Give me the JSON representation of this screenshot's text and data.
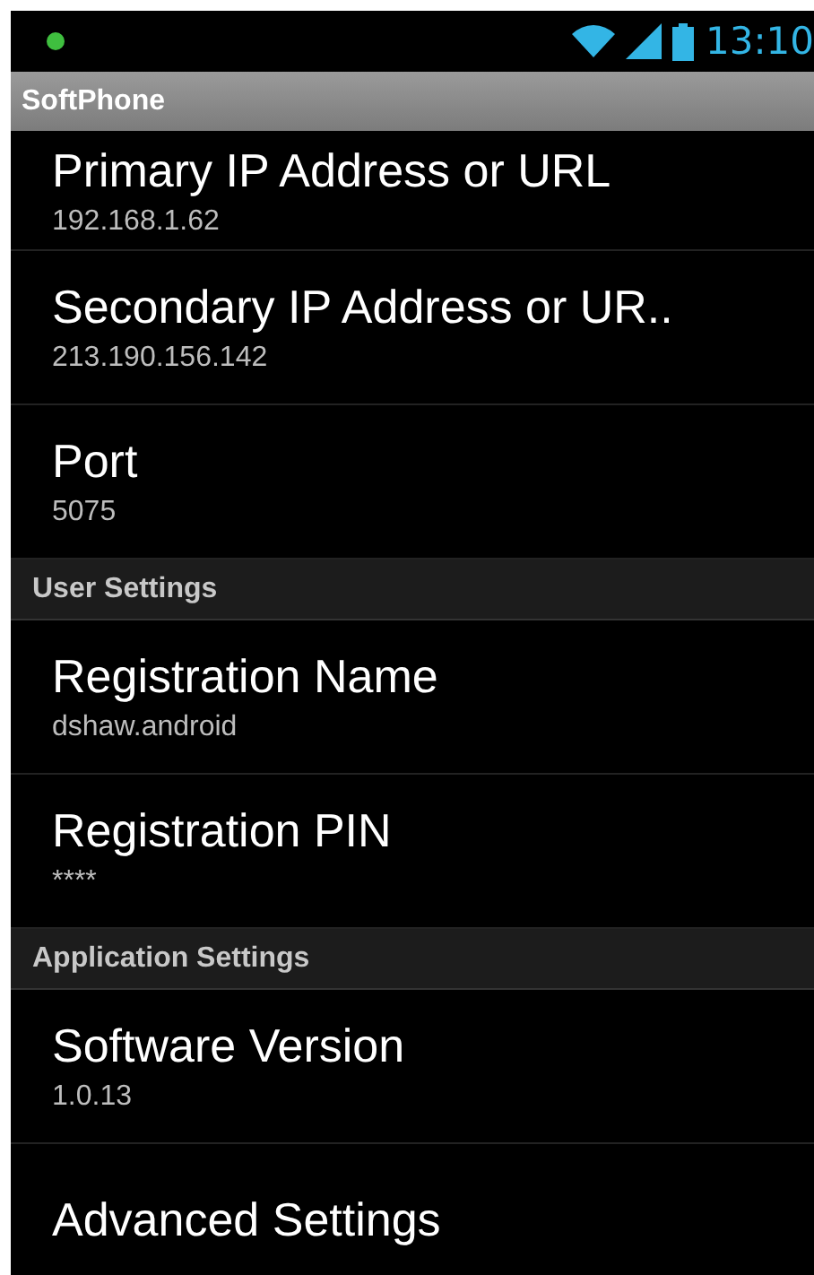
{
  "status_bar": {
    "notification": true,
    "time": "13:10"
  },
  "title_bar": {
    "title": "SoftPhone"
  },
  "items": [
    {
      "kind": "pref",
      "title": "Primary IP Address or URL",
      "summary": "192.168.1.62"
    },
    {
      "kind": "pref",
      "title": "Secondary IP Address or UR..",
      "summary": "213.190.156.142"
    },
    {
      "kind": "pref",
      "title": "Port",
      "summary": "5075"
    },
    {
      "kind": "header",
      "title": "User Settings"
    },
    {
      "kind": "pref",
      "title": "Registration Name",
      "summary": "dshaw.android"
    },
    {
      "kind": "pref",
      "title": "Registration PIN",
      "summary": "****"
    },
    {
      "kind": "header",
      "title": "Application Settings"
    },
    {
      "kind": "pref",
      "title": "Software Version",
      "summary": "1.0.13"
    },
    {
      "kind": "pref",
      "title": "Advanced Settings"
    }
  ]
}
